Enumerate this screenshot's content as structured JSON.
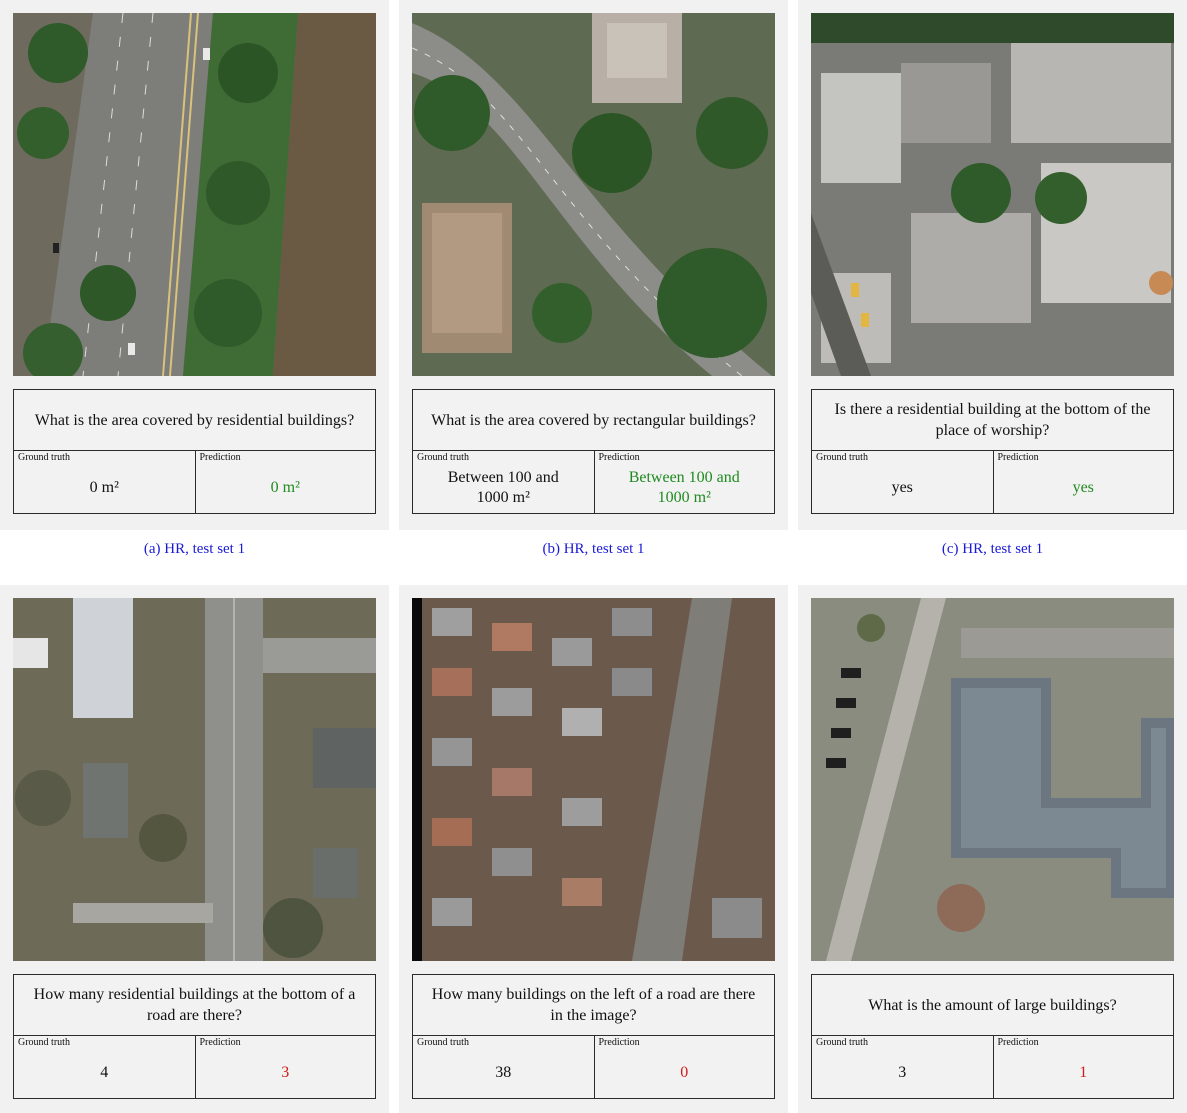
{
  "panels": [
    {
      "question": "What is the area covered by residential buildings?",
      "ground_truth_label": "Ground truth",
      "prediction_label": "Prediction",
      "ground_truth": "0 m²",
      "prediction": "0 m²",
      "prediction_color": "#1f8a1f",
      "caption": "(a) HR, test set 1"
    },
    {
      "question": "What is the area covered by rectangular buildings?",
      "ground_truth_label": "Ground truth",
      "prediction_label": "Prediction",
      "ground_truth": "Between 100 and 1000 m²",
      "prediction": "Between 100 and 1000 m²",
      "prediction_color": "#1f8a1f",
      "caption": "(b) HR, test set 1"
    },
    {
      "question": "Is there a residential building at the bottom of the place of worship?",
      "ground_truth_label": "Ground truth",
      "prediction_label": "Prediction",
      "ground_truth": "yes",
      "prediction": "yes",
      "prediction_color": "#1f8a1f",
      "caption": "(c) HR, test set 1"
    },
    {
      "question": "How many residential buildings at the bottom of a road are there?",
      "ground_truth_label": "Ground truth",
      "prediction_label": "Prediction",
      "ground_truth": "4",
      "prediction": "3",
      "prediction_color": "#d11a1a"
    },
    {
      "question": "How many buildings on the left of a road are there in the image?",
      "ground_truth_label": "Ground truth",
      "prediction_label": "Prediction",
      "ground_truth": "38",
      "prediction": "0",
      "prediction_color": "#d11a1a"
    },
    {
      "question": "What is the amount of large buildings?",
      "ground_truth_label": "Ground truth",
      "prediction_label": "Prediction",
      "ground_truth": "3",
      "prediction": "1",
      "prediction_color": "#d11a1a"
    }
  ]
}
